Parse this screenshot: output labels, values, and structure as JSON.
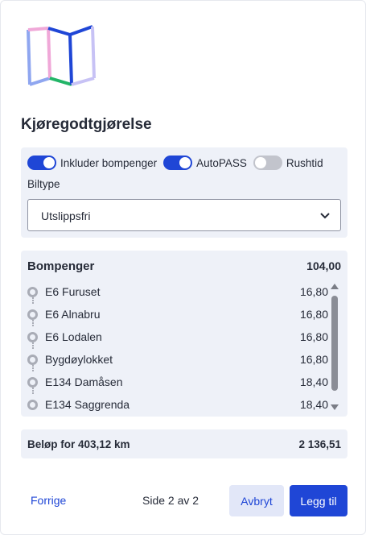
{
  "dialog": {
    "title": "Kjøregodtgjørelse"
  },
  "options": {
    "toggles": [
      {
        "label": "Inkluder bompenger",
        "on": true
      },
      {
        "label": "AutoPASS",
        "on": true
      },
      {
        "label": "Rushtid",
        "on": false
      }
    ],
    "biltype_label": "Biltype",
    "biltype_value": "Utslippsfri"
  },
  "tolls": {
    "heading": "Bompenger",
    "total": "104,00",
    "items": [
      {
        "name": "E6 Furuset",
        "value": "16,80"
      },
      {
        "name": "E6 Alnabru",
        "value": "16,80"
      },
      {
        "name": "E6 Lodalen",
        "value": "16,80"
      },
      {
        "name": "Bygdøylokket",
        "value": "16,80"
      },
      {
        "name": "E134 Damåsen",
        "value": "18,40"
      },
      {
        "name": "E134 Saggrenda",
        "value": "18,40"
      }
    ]
  },
  "amount": {
    "label": "Beløp for 403,12 km",
    "value": "2 136,51"
  },
  "footer": {
    "prev_label": "Forrige",
    "page_info": "Side 2 av 2",
    "cancel_label": "Avbryt",
    "add_label": "Legg til"
  },
  "colors": {
    "accent": "#1f46d6",
    "panel": "#eef1f8",
    "logo_pink": "#f0a8d8",
    "logo_lightblue": "#8fa6f0",
    "logo_blue": "#1f46d6",
    "logo_green": "#22b567",
    "logo_lavender": "#c7c2f5"
  }
}
